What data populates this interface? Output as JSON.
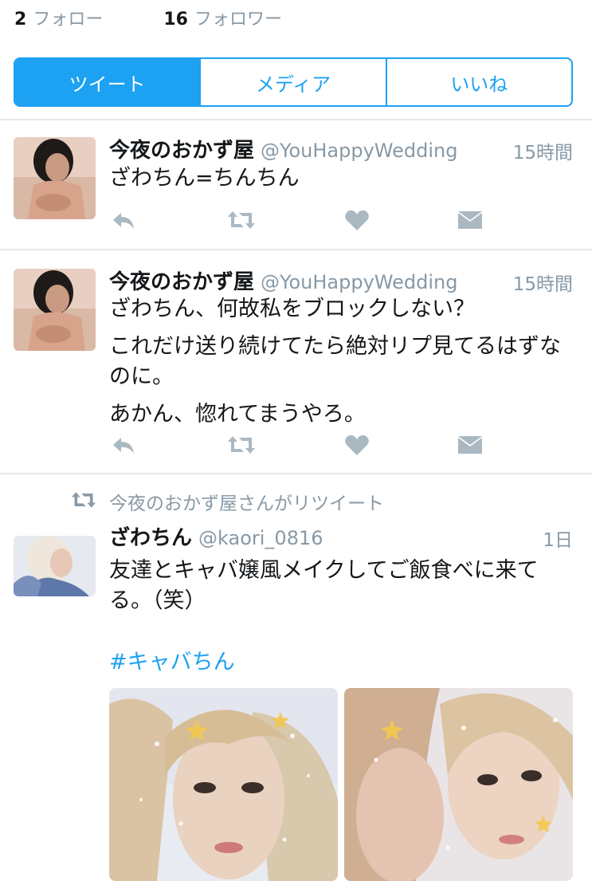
{
  "profile_stats": {
    "following_count": "2",
    "following_label": "フォロー",
    "followers_count": "16",
    "followers_label": "フォロワー"
  },
  "tabs": [
    {
      "label": "ツイート",
      "active": true
    },
    {
      "label": "メディア",
      "active": false
    },
    {
      "label": "いいね",
      "active": false
    }
  ],
  "tweets": [
    {
      "name": "今夜のおかず屋",
      "handle": "@YouHappyWedding",
      "time": "15時間",
      "lines": [
        "ざわちん=ちんちん"
      ]
    },
    {
      "name": "今夜のおかず屋",
      "handle": "@YouHappyWedding",
      "time": "15時間",
      "lines": [
        "ざわちん、何故私をブロックしない？",
        "これだけ送り続けてたら絶対リプ見てるはずなのに。",
        "あかん、惚れてまうやろ。"
      ]
    },
    {
      "retweet_label": "今夜のおかず屋さんがリツイート",
      "name": "ざわちん",
      "handle": "@kaori_0816",
      "time": "1日",
      "lines": [
        "友達とキャバ嬢風メイクしてご飯食べに来てる。（笑）"
      ],
      "hashtag": "#キャバちん"
    }
  ],
  "colors": {
    "accent": "#1da1f2",
    "muted": "#8899a6",
    "icon": "#aab8c2"
  },
  "icons": [
    "reply-icon",
    "retweet-icon",
    "like-icon",
    "dm-icon"
  ]
}
